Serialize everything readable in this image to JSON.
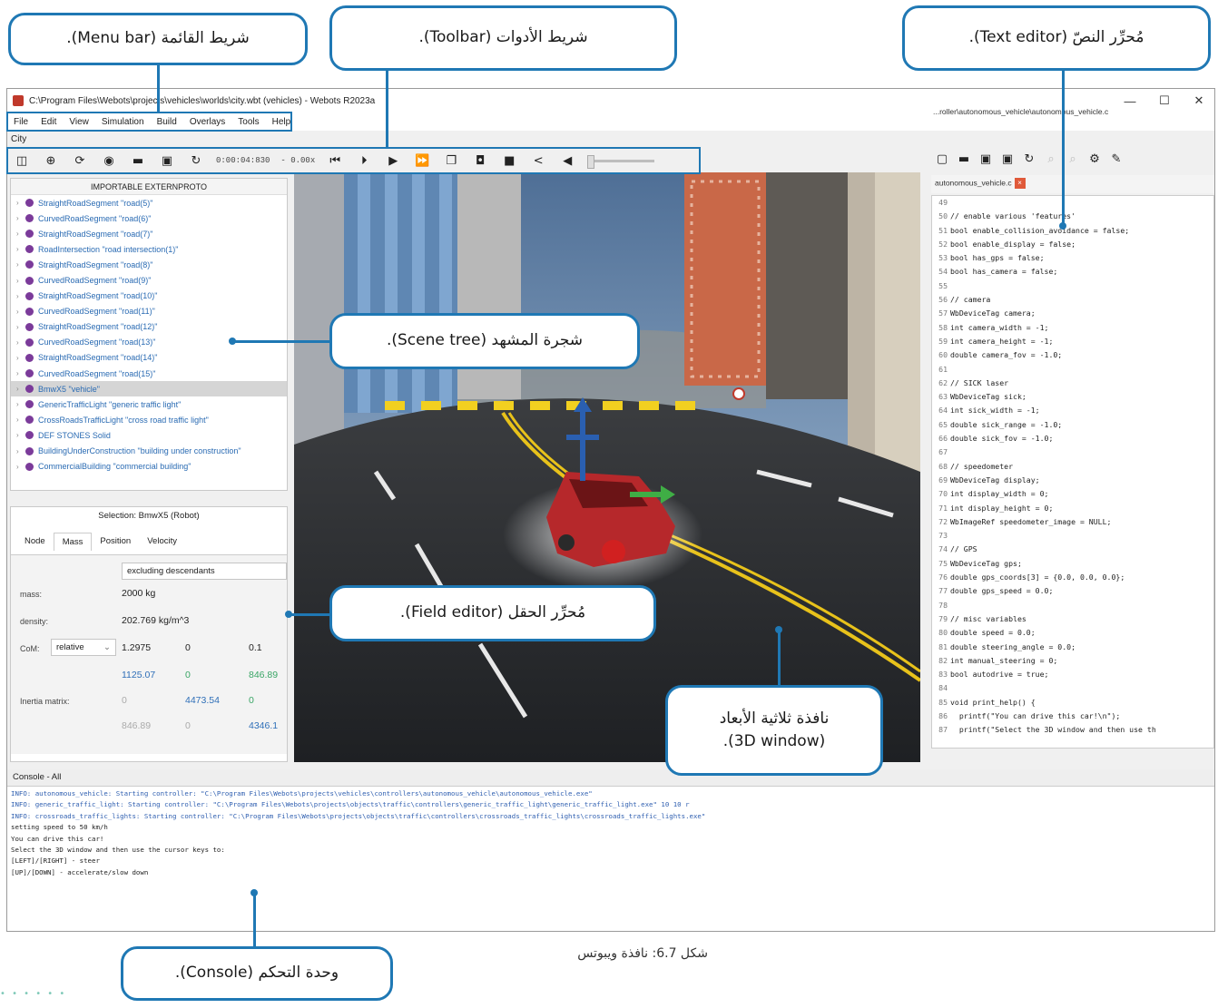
{
  "callouts": {
    "menu_bar": "شريط القائمة (Menu bar).",
    "toolbar": "شريط الأدوات (Toolbar).",
    "text_editor": "مُحرِّر النصّ (Text editor).",
    "scene_tree": "شجرة المشهد (Scene tree).",
    "field_editor": "مُحرِّر الحقل (Field editor).",
    "window_3d_line1": "نافذة ثلاثية الأبعاد",
    "window_3d_line2": "(3D window).",
    "console": "وحدة التحكم (Console)."
  },
  "caption": "شكل 6.7: نافذة ويبوتس",
  "window": {
    "title": "C:\\Program Files\\Webots\\projects\\vehicles\\worlds\\city.wbt (vehicles) - Webots R2023a",
    "minimize": "—",
    "maximize": "☐",
    "close": "✕",
    "menu": [
      "File",
      "Edit",
      "View",
      "Simulation",
      "Build",
      "Overlays",
      "Tools",
      "Help"
    ],
    "view_title": "City"
  },
  "toolbar": {
    "time": "0:00:04:830",
    "speed": "- 0.00x",
    "icons": [
      "view-toggle-icon",
      "add-node-icon",
      "rotate-icon",
      "eye-icon",
      "open-folder-icon",
      "save-icon",
      "reload-icon",
      "step-back-icon",
      "step-icon",
      "play-icon",
      "fast-forward-icon",
      "window-icon",
      "camera-icon",
      "record-icon",
      "share-icon",
      "volume-icon"
    ]
  },
  "scene_tree": {
    "header": "IMPORTABLE EXTERNPROTO",
    "items": [
      "StraightRoadSegment \"road(5)\"",
      "CurvedRoadSegment \"road(6)\"",
      "StraightRoadSegment \"road(7)\"",
      "RoadIntersection \"road intersection(1)\"",
      "StraightRoadSegment \"road(8)\"",
      "CurvedRoadSegment \"road(9)\"",
      "StraightRoadSegment \"road(10)\"",
      "CurvedRoadSegment \"road(11)\"",
      "StraightRoadSegment \"road(12)\"",
      "CurvedRoadSegment \"road(13)\"",
      "StraightRoadSegment \"road(14)\"",
      "CurvedRoadSegment \"road(15)\"",
      "BmwX5 \"vehicle\"",
      "GenericTrafficLight \"generic traffic light\"",
      "CrossRoadsTrafficLight \"cross road traffic light\"",
      "DEF STONES Solid",
      "BuildingUnderConstruction \"building under construction\"",
      "CommercialBuilding \"commercial building\""
    ],
    "selected_index": 12
  },
  "field_editor": {
    "title": "Selection: BmwX5 (Robot)",
    "tabs": [
      "Node",
      "Mass",
      "Position",
      "Velocity"
    ],
    "active_tab": "Mass",
    "dropdown": "excluding descendants",
    "mass_label": "mass:",
    "mass_value": "2000 kg",
    "density_label": "density:",
    "density_value": "202.769 kg/m^3",
    "com_label": "CoM:",
    "com_mode": "relative",
    "com": [
      "1.2975",
      "0",
      "0.1"
    ],
    "row2": [
      "1125.07",
      "0",
      "846.89"
    ],
    "inertia_label": "Inertia matrix:",
    "row3": [
      "0",
      "4473.54",
      "0"
    ],
    "row4": [
      "846.89",
      "0",
      "4346.1"
    ]
  },
  "text_editor": {
    "path": "...roller\\autonomous_vehicle\\autonomous_vehicle.c",
    "tab": "autonomous_vehicle.c",
    "lines": [
      [
        "49",
        ""
      ],
      [
        "50",
        "// enable various 'features'"
      ],
      [
        "51",
        "bool enable_collision_avoidance = false;"
      ],
      [
        "52",
        "bool enable_display = false;"
      ],
      [
        "53",
        "bool has_gps = false;"
      ],
      [
        "54",
        "bool has_camera = false;"
      ],
      [
        "55",
        ""
      ],
      [
        "56",
        "// camera"
      ],
      [
        "57",
        "WbDeviceTag camera;"
      ],
      [
        "58",
        "int camera_width = -1;"
      ],
      [
        "59",
        "int camera_height = -1;"
      ],
      [
        "60",
        "double camera_fov = -1.0;"
      ],
      [
        "61",
        ""
      ],
      [
        "62",
        "// SICK laser"
      ],
      [
        "63",
        "WbDeviceTag sick;"
      ],
      [
        "64",
        "int sick_width = -1;"
      ],
      [
        "65",
        "double sick_range = -1.0;"
      ],
      [
        "66",
        "double sick_fov = -1.0;"
      ],
      [
        "67",
        ""
      ],
      [
        "68",
        "// speedometer"
      ],
      [
        "69",
        "WbDeviceTag display;"
      ],
      [
        "70",
        "int display_width = 0;"
      ],
      [
        "71",
        "int display_height = 0;"
      ],
      [
        "72",
        "WbImageRef speedometer_image = NULL;"
      ],
      [
        "73",
        ""
      ],
      [
        "74",
        "// GPS"
      ],
      [
        "75",
        "WbDeviceTag gps;"
      ],
      [
        "76",
        "double gps_coords[3] = {0.0, 0.0, 0.0};"
      ],
      [
        "77",
        "double gps_speed = 0.0;"
      ],
      [
        "78",
        ""
      ],
      [
        "79",
        "// misc variables"
      ],
      [
        "80",
        "double speed = 0.0;"
      ],
      [
        "81",
        "double steering_angle = 0.0;"
      ],
      [
        "82",
        "int manual_steering = 0;"
      ],
      [
        "83",
        "bool autodrive = true;"
      ],
      [
        "84",
        ""
      ],
      [
        "85",
        "void print_help() {"
      ],
      [
        "86",
        "  printf(\"You can drive this car!\\n\");"
      ],
      [
        "87",
        "  printf(\"Select the 3D window and then use th"
      ]
    ]
  },
  "console": {
    "title": "Console - All",
    "lines": [
      "INFO: autonomous_vehicle: Starting controller: \"C:\\Program Files\\Webots\\projects\\vehicles\\controllers\\autonomous_vehicle\\autonomous_vehicle.exe\"",
      "INFO: generic_traffic_light: Starting controller: \"C:\\Program Files\\Webots\\projects\\objects\\traffic\\controllers\\generic_traffic_light\\generic_traffic_light.exe\" 10 10 r",
      "INFO: crossroads_traffic_lights: Starting controller: \"C:\\Program Files\\Webots\\projects\\objects\\traffic\\controllers\\crossroads_traffic_lights\\crossroads_traffic_lights.exe\"",
      "setting speed to 50 km/h",
      "You can drive this car!",
      "Select the 3D window and then use the cursor keys to:",
      "[LEFT]/[RIGHT] - steer",
      "[UP]/[DOWN] - accelerate/slow down"
    ]
  },
  "colors": {
    "callout_border": "#1f78b4",
    "road": "#2b2d30",
    "sky": "#8ca7c4",
    "lane_yellow": "#e8c21b"
  }
}
